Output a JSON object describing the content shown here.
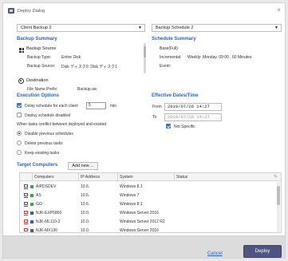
{
  "window": {
    "title": "Deploy Dialog",
    "close_icon": "close-icon"
  },
  "selects": {
    "client_backup": "Client Backup 2",
    "backup_schedule": "Backup Schedule 2"
  },
  "backup_summary": {
    "title": "Backup Summary",
    "source_heading": "Backup Source",
    "type_label": "Backup Type:",
    "type_value": "Entire Disk",
    "source_label": "Backup Source:",
    "source_value": "Disk ディスク0: Disk ディスク1",
    "destination_heading": "Destination",
    "prefix_label": "File Name Prefix:",
    "prefix_value": "Backup.aiv"
  },
  "schedule_summary": {
    "title": "Schedule Summary",
    "base_label": "Base(Full):",
    "incremental_label": "Incremental:",
    "incremental_value": "Weekly: Monday, 09:00 , 60 Minutes",
    "event_label": "Event:"
  },
  "execution": {
    "title": "Execution Options",
    "delay_label": "Delay schedule for each client",
    "delay_value": "5",
    "delay_unit": "min",
    "disabled_label": "Deploy schedule disabled",
    "conflict_label": "When tasks conflict between deployed and existed",
    "options": [
      "Disable previous schedules",
      "Delete previous tasks",
      "Keep existing tasks"
    ]
  },
  "effective": {
    "title": "Effective Dates/Time",
    "from_label": "From",
    "from_value": "2019/07/26 14:27",
    "to_label": "To",
    "to_value": "2019/07/26 14:27",
    "not_specific_label": "Not Specific"
  },
  "targets": {
    "title": "Target Computers",
    "add_label": "Add new ...",
    "columns": [
      "Computers",
      "IP Address",
      "System",
      "Status"
    ],
    "rows": [
      {
        "name": "AIPDSDEV",
        "ip": "10.6.",
        "system": "Windows 8.1"
      },
      {
        "name": "AS",
        "ip": "10.6.",
        "system": "Windows 7"
      },
      {
        "name": "GO",
        "ip": "10.6.",
        "system": "Windows 8.1"
      },
      {
        "name": "NJK-EXP5800",
        "ip": "10.0.",
        "system": "Windows Server 2016"
      },
      {
        "name": "NJK-ML110-2",
        "ip": "10.0.",
        "system": "Windows Server 2012 R2"
      },
      {
        "name": "NJK-MX130",
        "ip": "10.0.",
        "system": "Windows Server 2016"
      }
    ]
  },
  "footer": {
    "cancel_label": "Cancel",
    "deploy_label": "Deploy"
  }
}
